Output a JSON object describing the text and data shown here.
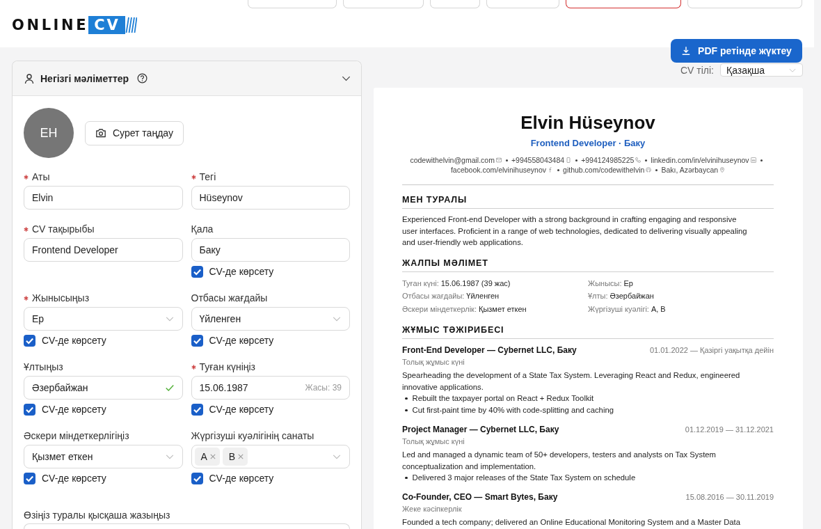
{
  "header": {
    "toolbar_buttons": [
      {
        "kind": "outline"
      },
      {
        "kind": "outline"
      },
      {
        "kind": "outline"
      },
      {
        "kind": "outline"
      },
      {
        "kind": "danger"
      },
      {
        "kind": "outline"
      }
    ],
    "logo": {
      "text": "ONLINE",
      "badge": "CV"
    },
    "download_button": {
      "label": "PDF ретінде жүктеу"
    }
  },
  "form_panel": {
    "title": "Негізгі мәліметтер",
    "expanded": true,
    "avatar": {
      "initials": "EH"
    },
    "photo_button": "Сурет таңдау",
    "fields": [
      {
        "label": "Аты",
        "required": true,
        "kind": "text",
        "value": "Elvin",
        "valid": false
      },
      {
        "label": "Тегі",
        "required": true,
        "kind": "text",
        "value": "Hüseynov",
        "valid": false
      },
      {
        "label": "CV тақырыбы",
        "required": true,
        "kind": "text",
        "value": "Frontend Developer",
        "valid": false
      },
      {
        "label": "Қала",
        "required": false,
        "kind": "text",
        "value": "Баку",
        "valid": false,
        "show_in_cv": {
          "label": "CV-де көрсету",
          "checked": true
        }
      },
      {
        "label": "Жынысыңыз",
        "required": true,
        "kind": "select",
        "value": "Ер",
        "valid": false,
        "show_in_cv": {
          "label": "CV-де көрсету",
          "checked": true
        }
      },
      {
        "label": "Отбасы жағдайы",
        "required": false,
        "kind": "select",
        "value": "Үйленген",
        "valid": false,
        "show_in_cv": {
          "label": "CV-де көрсету",
          "checked": true
        }
      },
      {
        "label": "Ұлтыңыз",
        "required": false,
        "kind": "text",
        "value": "Әзербайжан",
        "valid": true,
        "show_in_cv": {
          "label": "CV-де көрсету",
          "checked": true
        }
      },
      {
        "label": "Туған күніңіз",
        "required": true,
        "kind": "date",
        "value": "15.06.1987",
        "hint": "Жасы: 39",
        "valid": false,
        "show_in_cv": {
          "label": "CV-де көрсету",
          "checked": true
        }
      },
      {
        "label": "Әскери міндеткерлігіңіз",
        "required": false,
        "kind": "select",
        "value": "Қызмет еткен",
        "valid": false,
        "show_in_cv": {
          "label": "CV-де көрсету",
          "checked": true
        }
      },
      {
        "label": "Жүргізуші куәлігінің санаты",
        "required": false,
        "kind": "tags",
        "tags": [
          "A",
          "B"
        ],
        "valid": false,
        "show_in_cv": {
          "label": "CV-де көрсету",
          "checked": true
        }
      }
    ],
    "about": {
      "label": "Өзіңіз туралы қысқаша жазыңыз"
    }
  },
  "cv_preview": {
    "language": {
      "label": "CV тілі:",
      "value": "Қазақша"
    },
    "name": "Elvin Hüseynov",
    "headline": "Frontend Developer · Баку",
    "contacts": [
      {
        "kind": "email",
        "text": "codewithelvin@gmail.com"
      },
      {
        "kind": "mobile",
        "text": "+994558043484"
      },
      {
        "kind": "phone",
        "text": "+994124985225"
      },
      {
        "kind": "linkedin",
        "text": "linkedin.com/in/elvinihuseynov"
      },
      {
        "kind": "facebook",
        "text": "facebook.com/elvinihuseynov"
      },
      {
        "kind": "github",
        "text": "github.com/codewithelvin"
      },
      {
        "kind": "location",
        "text": "Bakı, Azərbaycan"
      }
    ],
    "sections": [
      {
        "kind": "text",
        "title": "МЕН ТУРАЛЫ",
        "text": "Experienced Front-end Developer with a strong background in crafting engaging and responsive user interfaces. Proficient in a range of web technologies, dedicated to delivering visually appealing and user-friendly web applications."
      },
      {
        "kind": "facts",
        "title": "ЖАЛПЫ МӘЛІМЕТ",
        "facts": [
          {
            "label": "Туған күні:",
            "value": "15.06.1987 (39 жас)"
          },
          {
            "label": "Жынысы:",
            "value": "Ер"
          },
          {
            "label": "Отбасы жағдайы:",
            "value": "Үйленген"
          },
          {
            "label": "Ұлты:",
            "value": "Әзербайжан"
          },
          {
            "label": "Әскери міндеткерлік:",
            "value": "Қызмет еткен"
          },
          {
            "label": "Жүргізуші куәлігі:",
            "value": "A, B"
          }
        ]
      },
      {
        "kind": "jobs",
        "title": "ЖҰМЫС ТӘЖІРИБЕСІ",
        "jobs": [
          {
            "title": "Front-End Developer — Cybernet LLC, Баку",
            "dates": "01.01.2022 — Қазіргі уақытқа дейін",
            "type": "Толық жұмыс күні",
            "description": "Spearheading the development of a State Tax System. Leveraging React and Redux, engineered innovative applications.",
            "bullets": [
              "Rebuilt the taxpayer portal on React + Redux Toolkit",
              "Cut first-paint time by 40% with code-splitting and caching"
            ]
          },
          {
            "title": "Project Manager — Cybernet LLC, Баку",
            "dates": "01.12.2019 — 31.12.2021",
            "type": "Толық жұмыс күні",
            "description": "Led and managed a dynamic team of 50+ developers, testers and analysts on Tax System conceptualization and implementation.",
            "bullets": [
              "Delivered 3 major releases of the State Tax System on schedule"
            ]
          },
          {
            "title": "Co-Founder, CEO — Smart Bytes, Баку",
            "dates": "15.08.2016 — 30.11.2019",
            "type": "Жеке кәсіпкерлік",
            "description": "Founded a tech company; delivered an Online Educational Monitoring System and a Master Data"
          }
        ]
      }
    ]
  }
}
